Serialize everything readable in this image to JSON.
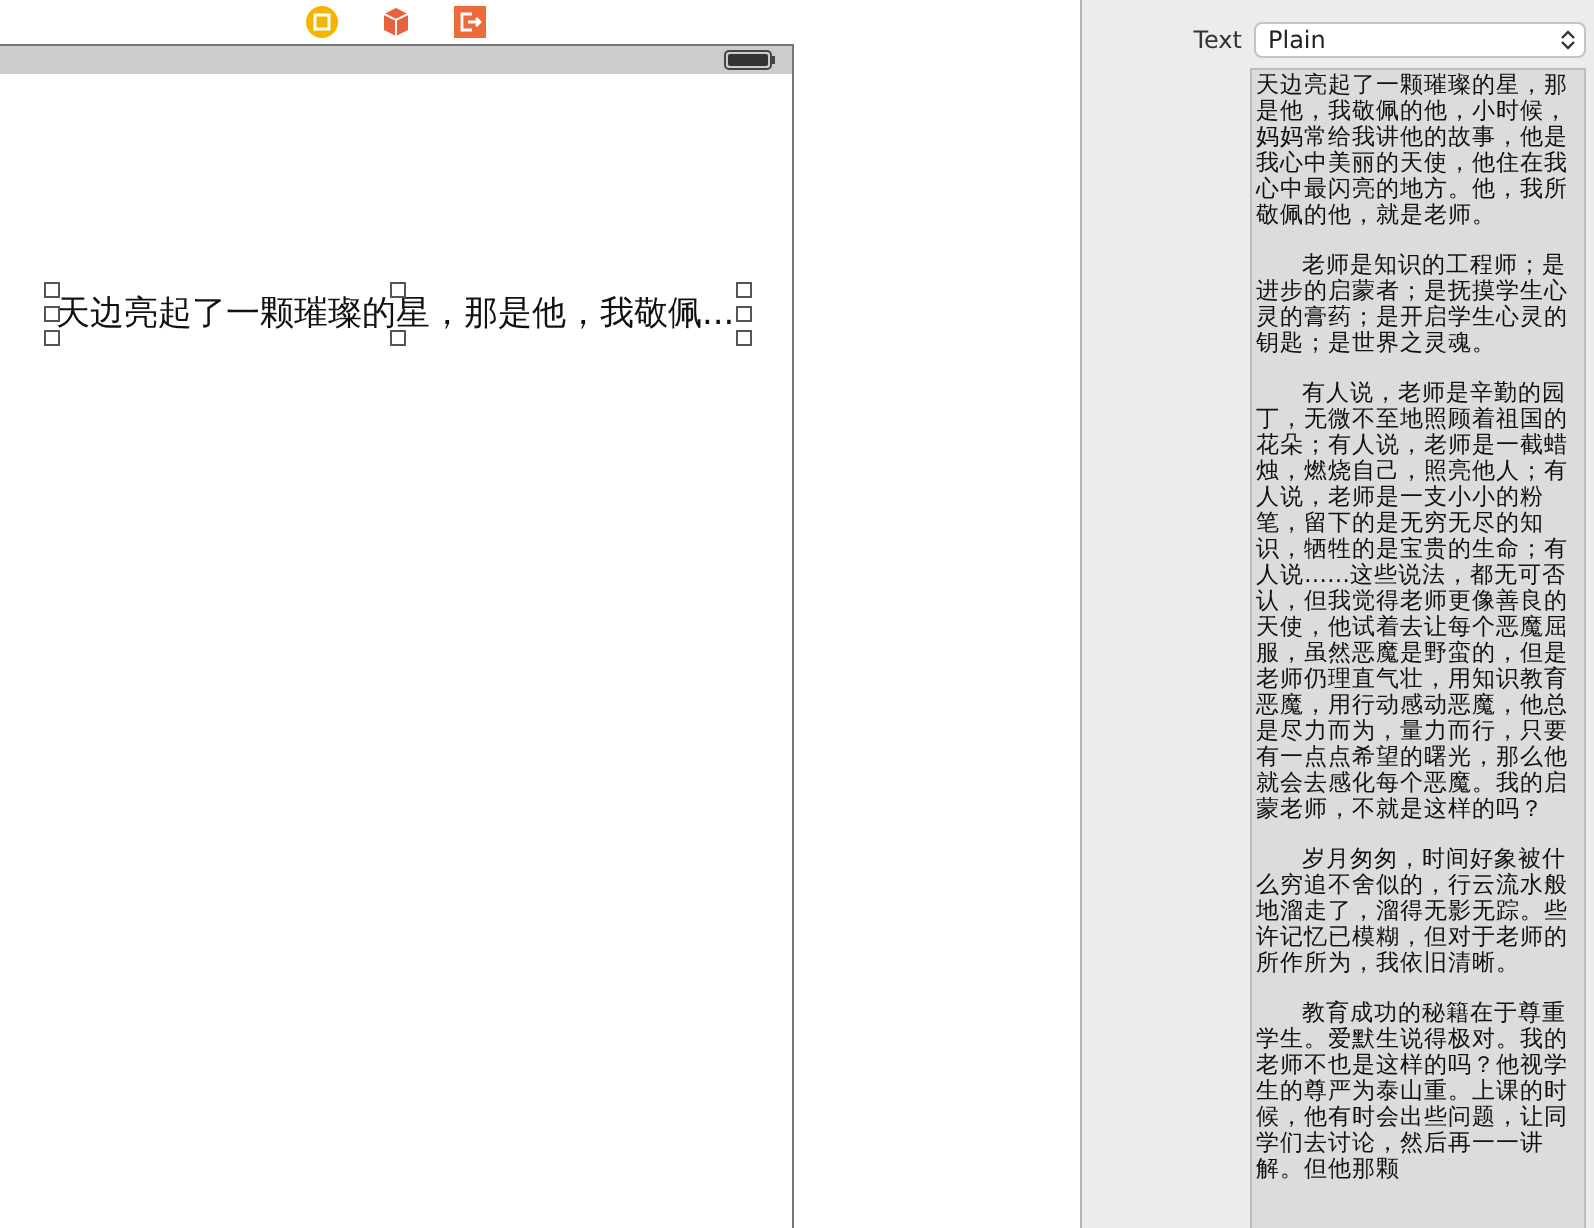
{
  "canvas_label": {
    "text": "天边亮起了一颗璀璨的星，那是他，我敬佩...",
    "selected": true
  },
  "inspector": {
    "text_type_label": "Text",
    "text_type": "Plain",
    "text_paragraphs": [
      "天边亮起了一颗璀璨的星，那是他，我敬佩的他，小时候，妈妈常给我讲他的故事，他是我心中美丽的天使，他住在我心中最闪亮的地方。他，我所敬佩的他，就是老师。",
      "老师是知识的工程师；是进步的启蒙者；是抚摸学生心灵的膏药；是开启学生心灵的钥匙；是世界之灵魂。",
      "有人说，老师是辛勤的园丁，无微不至地照顾着祖国的花朵；有人说，老师是一截蜡烛，燃烧自己，照亮他人；有人说，老师是一支小小的粉笔，留下的是无穷无尽的知识，牺牲的是宝贵的生命；有人说……这些说法，都无可否认，但我觉得老师更像善良的天使，他试着去让每个恶魔屈服，虽然恶魔是野蛮的，但是老师仍理直气壮，用知识教育恶魔，用行动感动恶魔，他总是尽力而为，量力而行，只要有一点点希望的曙光，那么他就会去感化每个恶魔。我的启蒙老师，不就是这样的吗？",
      "岁月匆匆，时间好象被什么穷追不舍似的，行云流水般地溜走了，溜得无影无踪。些许记忆已模糊，但对于老师的所作所为，我依旧清晰。",
      "教育成功的秘籍在于尊重学生。爱默生说得极对。我的老师不也是这样的吗？他视学生的尊严为泰山重。上课的时候，他有时会出些问题，让同学们去讨论，然后再一一讲解。但他那颗"
    ]
  }
}
